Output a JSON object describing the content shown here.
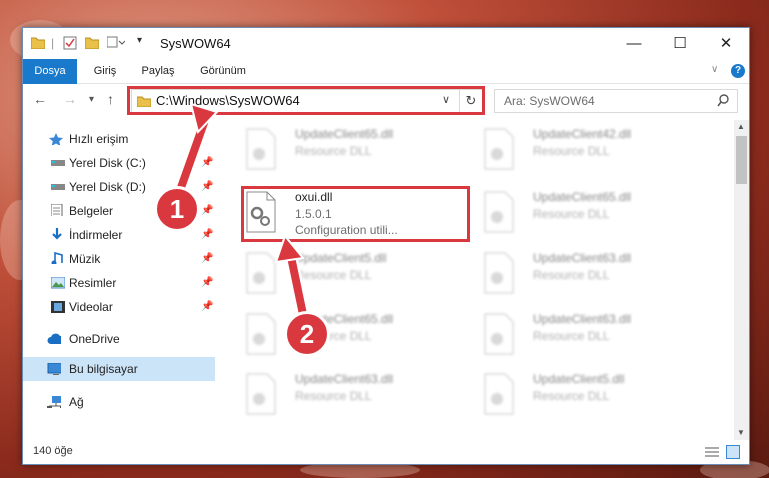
{
  "window": {
    "title": "SysWOW64",
    "controls": {
      "minimize": "—",
      "maximize": "☐",
      "close": "✕"
    }
  },
  "ribbon": {
    "tabs": [
      "Dosya",
      "Giriş",
      "Paylaş",
      "Görünüm"
    ],
    "help": "?"
  },
  "nav": {
    "address": "C:\\Windows\\SysWOW64",
    "search_placeholder": "Ara: SysWOW64"
  },
  "sidebar": {
    "items": [
      {
        "label": "Hızlı erişim",
        "icon": "star-icon"
      },
      {
        "label": "Yerel Disk (C:)",
        "icon": "drive-icon",
        "pinned": true
      },
      {
        "label": "Yerel Disk (D:)",
        "icon": "drive-icon",
        "pinned": true
      },
      {
        "label": "Belgeler",
        "icon": "documents-icon",
        "pinned": true
      },
      {
        "label": "İndirmeler",
        "icon": "download-icon",
        "pinned": true
      },
      {
        "label": "Müzik",
        "icon": "music-icon",
        "pinned": true
      },
      {
        "label": "Resimler",
        "icon": "pictures-icon",
        "pinned": true
      },
      {
        "label": "Videolar",
        "icon": "video-icon",
        "pinned": true
      },
      {
        "label": "OneDrive",
        "icon": "cloud-icon"
      },
      {
        "label": "Bu bilgisayar",
        "icon": "computer-icon",
        "selected": true
      },
      {
        "label": "Ağ",
        "icon": "network-icon"
      }
    ]
  },
  "files": {
    "highlighted": {
      "name": "oxui.dll",
      "version": "1.5.0.1",
      "description": "Configuration utili..."
    },
    "blurred": [
      {
        "name": "UpdateClient65.dll",
        "desc": "Resource DLL"
      },
      {
        "name": "UpdateClient42.dll",
        "desc": "Resource DLL"
      },
      {
        "name": "UpdateClient65.dll",
        "desc": "Resource DLL"
      },
      {
        "name": "UpdateClient5.dll",
        "desc": "Resource DLL"
      },
      {
        "name": "UpdateClient63.dll",
        "desc": "Resource DLL"
      },
      {
        "name": "UpdateClient65.dll",
        "desc": "Resource DLL"
      },
      {
        "name": "UpdateClient63.dll",
        "desc": "Resource DLL"
      },
      {
        "name": "UpdateClient63.dll",
        "desc": "Resource DLL"
      },
      {
        "name": "UpdateClient5.dll",
        "desc": "Resource DLL"
      }
    ]
  },
  "status": {
    "count": "140 öğe"
  },
  "callouts": {
    "one": "1",
    "two": "2"
  },
  "colors": {
    "accent": "#1979ca",
    "highlight": "#d9383f",
    "selected": "#cce4f7"
  }
}
